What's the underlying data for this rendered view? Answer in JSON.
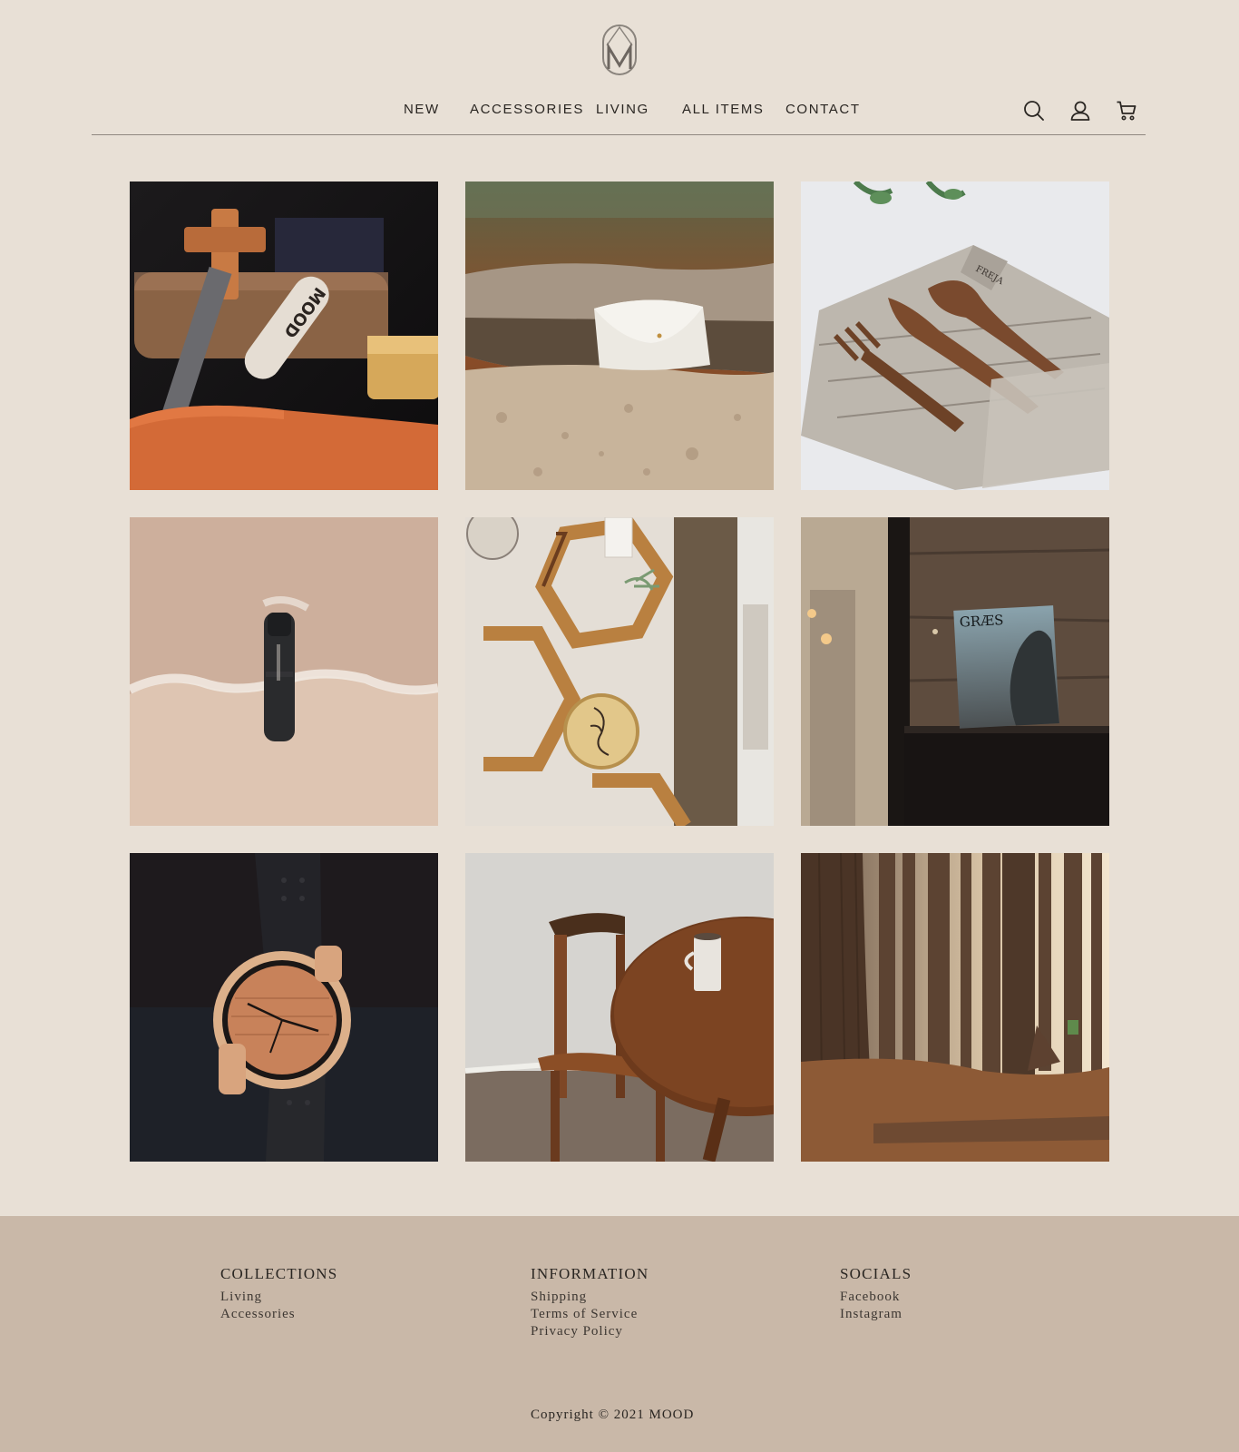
{
  "brand": {
    "logo_letter": "M",
    "logo_icon": "monogram-logo-icon"
  },
  "nav": {
    "items": [
      {
        "label": "NEW"
      },
      {
        "label": "ACCESSORIES"
      },
      {
        "label": "LIVING"
      },
      {
        "label": "ALL ITEMS"
      },
      {
        "label": "CONTACT"
      }
    ]
  },
  "header_icons": [
    "search-icon",
    "user-icon",
    "cart-icon"
  ],
  "gallery": {
    "tiles": [
      {
        "icon": "product-photo-mood-tag-pouch"
      },
      {
        "icon": "product-photo-fur-pouch-on-log"
      },
      {
        "icon": "product-photo-wooden-cutlery-wrap"
      },
      {
        "icon": "product-photo-black-bottle-beach"
      },
      {
        "icon": "product-photo-hexagon-shelves"
      },
      {
        "icon": "product-photo-graes-magazine"
      },
      {
        "icon": "product-photo-wooden-watch"
      },
      {
        "icon": "product-photo-chair-and-table"
      },
      {
        "icon": "product-photo-pine-forest"
      }
    ],
    "magazine_title": "GRÆS",
    "tag_text": "MOOD"
  },
  "footer": {
    "collections": {
      "heading": "COLLECTIONS",
      "links": [
        "Living",
        "Accessories"
      ]
    },
    "information": {
      "heading": "INFORMATION",
      "links": [
        "Shipping",
        "Terms of Service",
        "Privacy Policy"
      ]
    },
    "socials": {
      "heading": "SOCIALS",
      "links": [
        "Facebook",
        "Instagram"
      ]
    },
    "copyright": "Copyright © 2021 MOOD"
  },
  "colors": {
    "background": "#e8e0d6",
    "footer_background": "#c9b8a8",
    "text": "#2a2622"
  }
}
